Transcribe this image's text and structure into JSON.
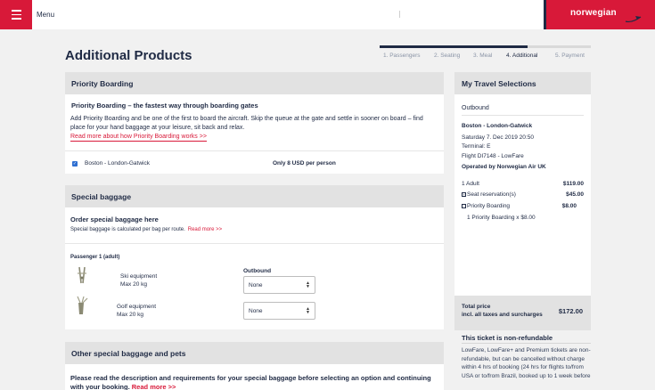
{
  "header": {
    "menu_label": "Menu",
    "logo_text": "norwegian"
  },
  "page": {
    "title": "Additional Products"
  },
  "progress": {
    "fraction_complete": 0.7,
    "steps": [
      "1. Passengers",
      "2. Seating",
      "3. Meal",
      "4. Additional",
      "5. Payment"
    ],
    "active_step": "4. Additional"
  },
  "priority_boarding": {
    "heading": "Priority Boarding",
    "title": "Priority Boarding – the fastest way through boarding gates",
    "description": "Add Priority Boarding and be one of the first to board the aircraft. Skip the queue at the gate and settle in sooner on board – find place for your hand baggage at your leisure, sit back and relax.",
    "link": "Read more about how Priority Boarding works >>",
    "route": "Boston - London-Gatwick",
    "price": "Only 8 USD per person",
    "checked": true
  },
  "special_baggage": {
    "heading": "Special baggage",
    "order_title": "Order special baggage here",
    "note": "Special baggage is calculated per bag per route.",
    "note_link": "Read more >>",
    "passenger": "Passenger 1 (adult)",
    "outbound_label": "Outbound",
    "items": [
      {
        "name": "Ski equipment",
        "max": "Max 20 kg",
        "selected": "None"
      },
      {
        "name": "Golf equipment",
        "max": "Max 20 kg",
        "selected": "None"
      }
    ]
  },
  "other_baggage": {
    "heading": "Other special baggage and pets",
    "text": "Please read the description and requirements for your special baggage before selecting an option and continuing with your booking.",
    "link": "Read more >>"
  },
  "selections": {
    "heading": "My Travel Selections",
    "outbound": "Outbound",
    "route": "Boston - London-Gatwick",
    "date": "Saturday 7. Dec 2019 20:50",
    "terminal": "Terminal: E",
    "flight": "Flight DI7148 - LowFare",
    "operator": "Operated by Norwegian Air UK",
    "lines": [
      {
        "label": "1 Adult",
        "amount": "$119.00",
        "expandable": false
      },
      {
        "label": "Seat reservation(s)",
        "amount": "$45.00",
        "expandable": true
      },
      {
        "label": "Priority Boarding",
        "amount": "$8.00",
        "expandable": true
      }
    ],
    "sub_item": "1 Priority Boarding x $8.00",
    "total_label_1": "Total price",
    "total_label_2": "incl. all taxes and surcharges",
    "total_amount": "$172.00"
  },
  "non_refundable": {
    "title": "This ticket is non-refundable",
    "text": "LowFare, LowFare+ and Premium tickets are non-refundable, but can be cancelled without charge within 4 hrs of booking (24 hrs for flights to/from USA or to/from Brazil, booked up to 1 week before"
  },
  "colors": {
    "brand_red": "#d81939",
    "navy": "#1f2a44",
    "checkbox_blue": "#2e6fd1"
  }
}
